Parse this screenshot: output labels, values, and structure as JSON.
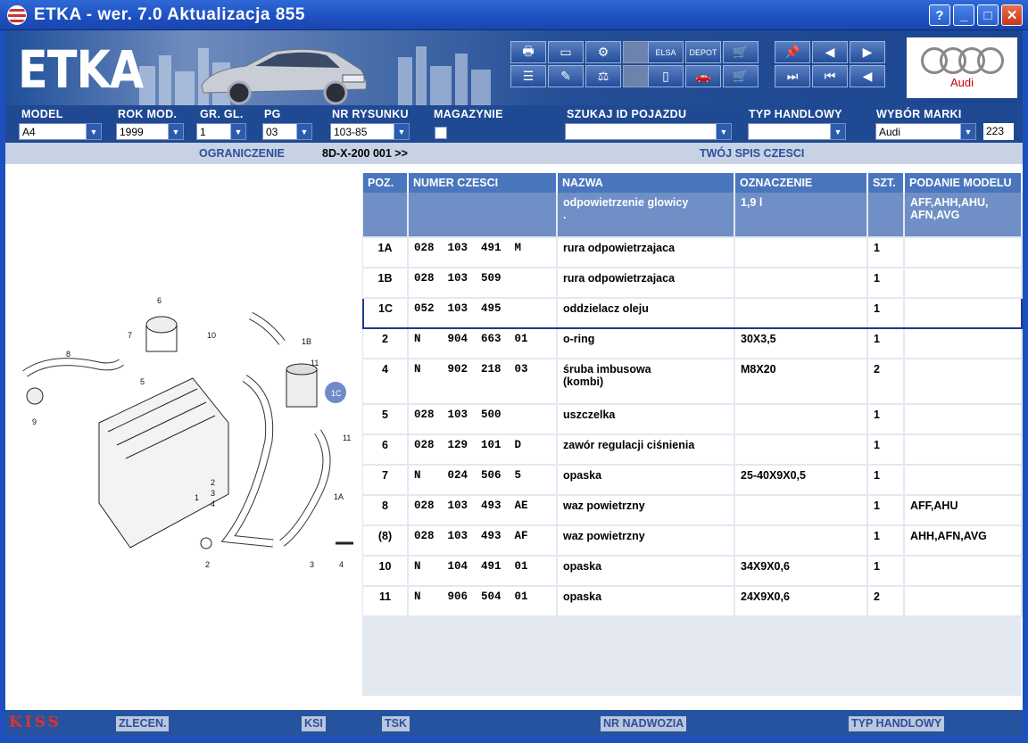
{
  "window": {
    "title": "ETKA - wer. 7.0 Aktualizacja 855"
  },
  "banner": {
    "logo": "ETKA",
    "brand_label": "Audi",
    "elsa": "ELSA",
    "depot": "DEPOT"
  },
  "selectors": {
    "model_label": "MODEL",
    "model_value": "A4",
    "rok_label": "ROK MOD.",
    "rok_value": "1999",
    "gr_label": "GR. GL.",
    "gr_value": "1",
    "pg_label": "PG",
    "pg_value": "03",
    "nr_label": "NR RYSUNKU",
    "nr_value": "103-85",
    "mag_label": "MAGAZYNIE",
    "szukaj_label": "SZUKAJ ID POJAZDU",
    "szukaj_value": "",
    "typ_label": "TYP HANDLOWY",
    "typ_value": "",
    "marka_label": "WYBÓR MARKI",
    "marka_value": "Audi",
    "count": "223"
  },
  "subheader": {
    "ograniczenie": "OGRANICZENIE",
    "code": "8D-X-200 001 >>",
    "spis": "TWÓJ SPIS CZESCI"
  },
  "table": {
    "headers": [
      "POZ.",
      "NUMER CZESCI",
      "NAZWA",
      "OZNACZENIE",
      "SZT.",
      "PODANIE MODELU"
    ],
    "group": {
      "nazwa": "odpowietrzenie glowicy",
      "nazwa2": ".",
      "oznaczenie": "1,9 l",
      "model": "AFF,AHH,AHU,\nAFN,AVG"
    },
    "rows": [
      {
        "poz": "1A",
        "num": "028  103  491  M",
        "nazwa": "rura odpowietrzajaca",
        "ozn": "",
        "szt": "1",
        "model": ""
      },
      {
        "poz": "1B",
        "num": "028  103  509",
        "nazwa": "rura odpowietrzajaca",
        "ozn": "",
        "szt": "1",
        "model": ""
      },
      {
        "poz": "1C",
        "num": "052  103  495",
        "nazwa": "oddzielacz oleju",
        "ozn": "",
        "szt": "1",
        "model": ""
      },
      {
        "poz": "2",
        "num": "N    904  663  01",
        "nazwa": "o-ring",
        "ozn": "30X3,5",
        "szt": "1",
        "model": ""
      },
      {
        "poz": "4",
        "num": "N    902  218  03",
        "nazwa": "śruba imbusowa\n(kombi)",
        "ozn": "M8X20",
        "szt": "2",
        "model": ""
      },
      {
        "poz": "5",
        "num": "028  103  500",
        "nazwa": "uszczelka",
        "ozn": "",
        "szt": "1",
        "model": ""
      },
      {
        "poz": "6",
        "num": "028  129  101  D",
        "nazwa": "zawór regulacji ciśnienia",
        "ozn": "",
        "szt": "1",
        "model": ""
      },
      {
        "poz": "7",
        "num": "N    024  506  5",
        "nazwa": "opaska",
        "ozn": "25-40X9X0,5",
        "szt": "1",
        "model": ""
      },
      {
        "poz": "8",
        "num": "028  103  493  AE",
        "nazwa": "waz powietrzny",
        "ozn": "",
        "szt": "1",
        "model": "AFF,AHU"
      },
      {
        "poz": "(8)",
        "num": "028  103  493  AF",
        "nazwa": "waz powietrzny",
        "ozn": "",
        "szt": "1",
        "model": "AHH,AFN,AVG"
      },
      {
        "poz": "10",
        "num": "N    104  491  01",
        "nazwa": "opaska",
        "ozn": "34X9X0,6",
        "szt": "1",
        "model": ""
      },
      {
        "poz": "11",
        "num": "N    906  504  01",
        "nazwa": "opaska",
        "ozn": "24X9X0,6",
        "szt": "2",
        "model": ""
      }
    ]
  },
  "diagram": {
    "labels": [
      "6",
      "7",
      "10",
      "8",
      "5",
      "9",
      "1B",
      "11",
      "1C",
      "11",
      "2",
      "3",
      "4",
      "1",
      "1A",
      "2",
      "3",
      "4"
    ]
  },
  "bottombar": {
    "kiss": "KISS",
    "zlecen": "ZLECEN.",
    "ksi": "KSI",
    "tsk": "TSK",
    "nadwozia": "NR NADWOZIA",
    "typ": "TYP HANDLOWY"
  }
}
